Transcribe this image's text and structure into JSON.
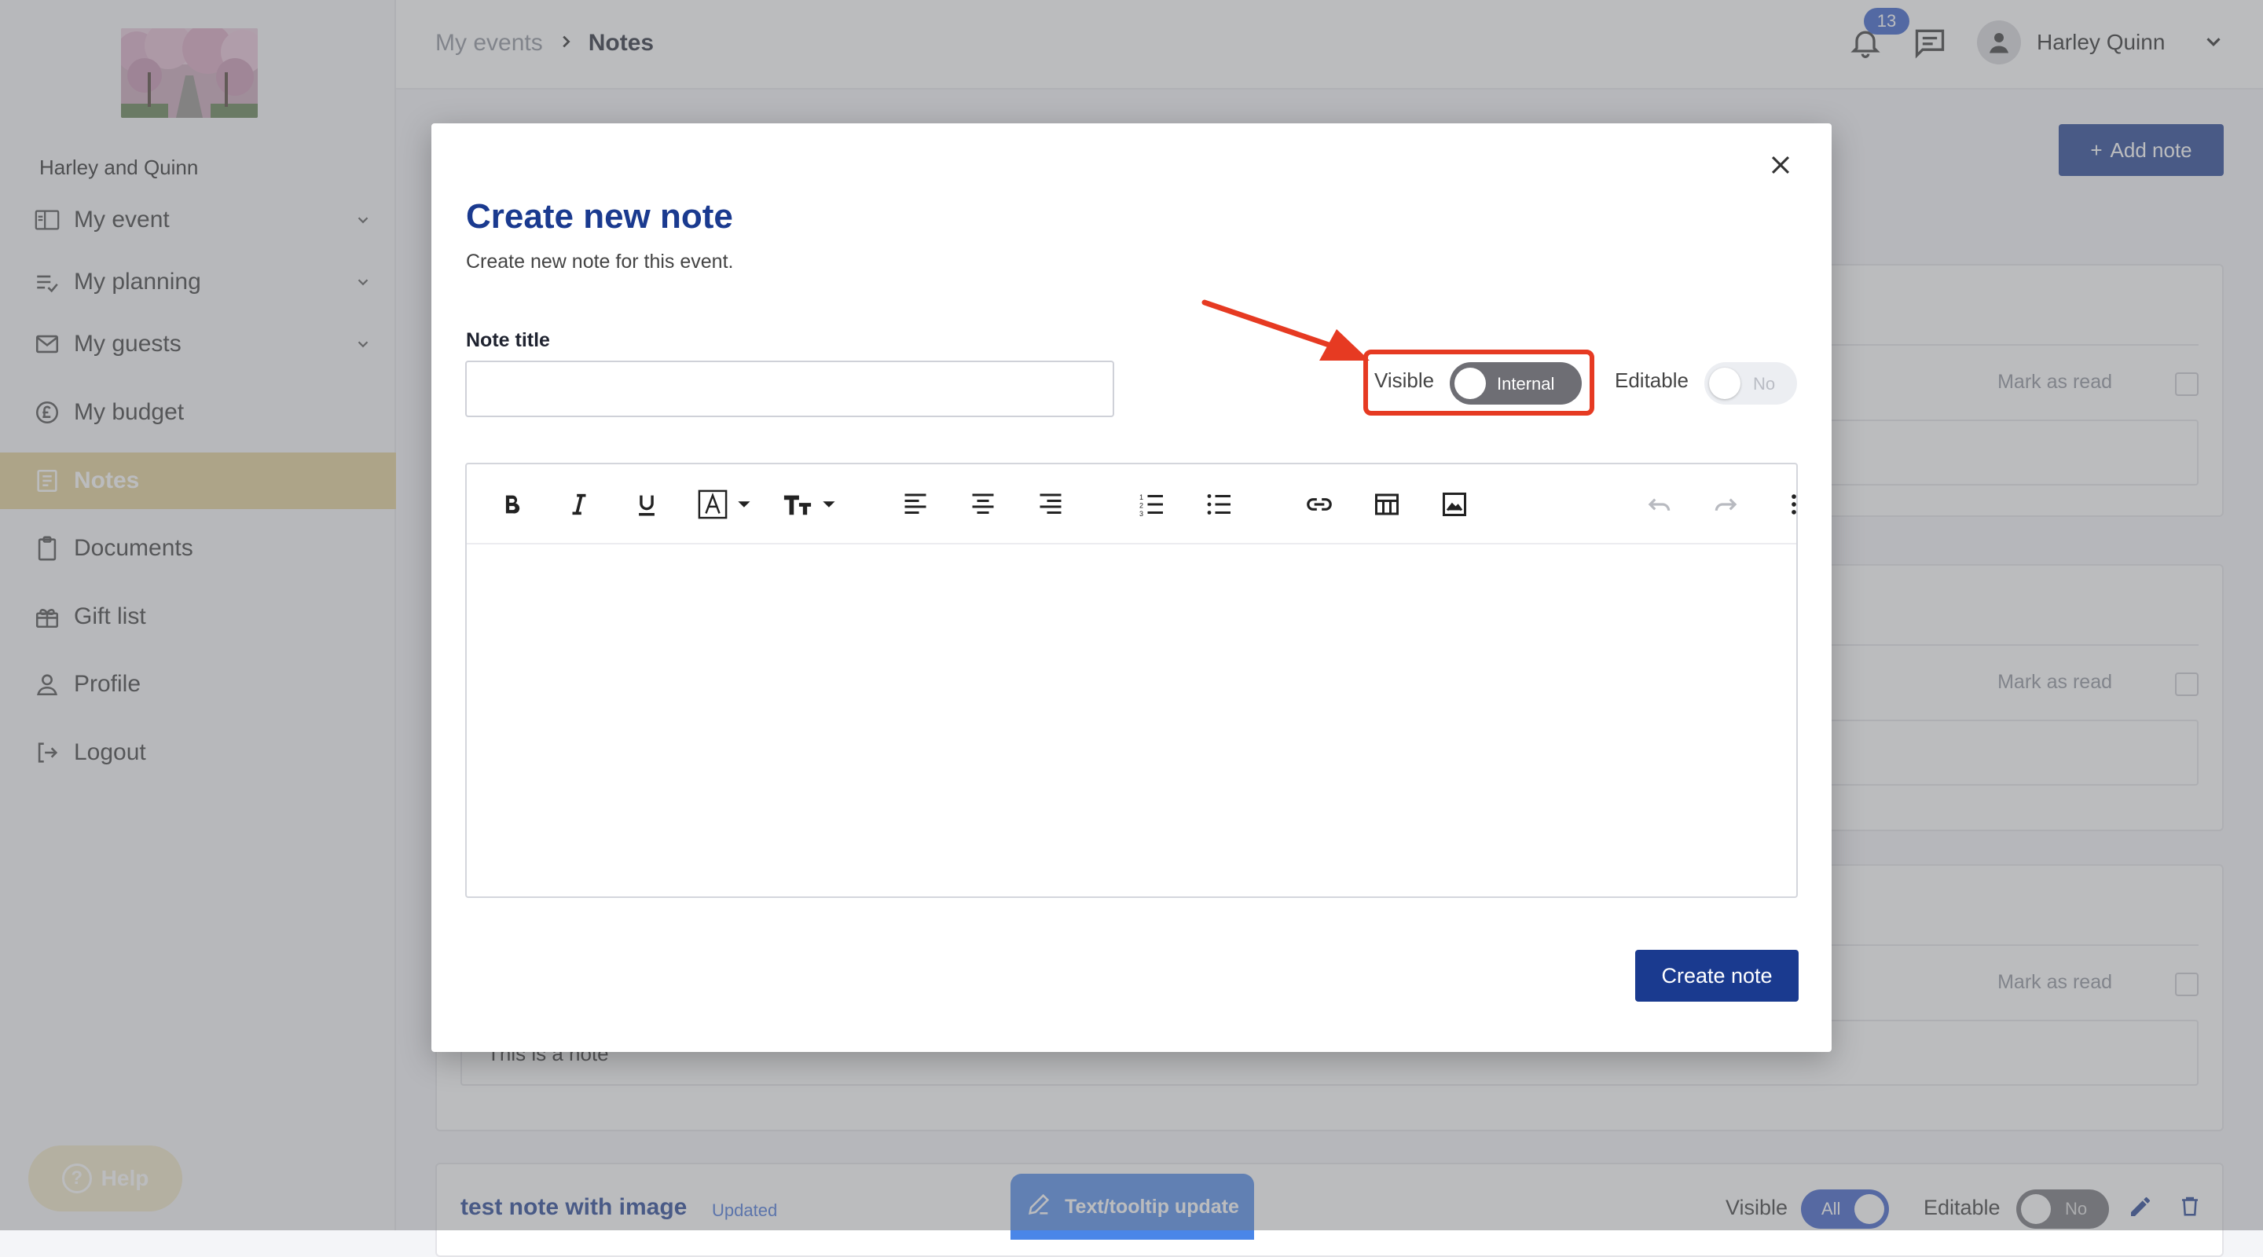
{
  "sidebar": {
    "event_name": "Harley and Quinn",
    "items": [
      {
        "label": "My event",
        "icon": "event-card-icon",
        "has_chevron": true
      },
      {
        "label": "My planning",
        "icon": "planning-list-icon",
        "has_chevron": true
      },
      {
        "label": "My guests",
        "icon": "mail-icon",
        "has_chevron": true
      },
      {
        "label": "My budget",
        "icon": "pound-coin-icon",
        "has_chevron": false
      },
      {
        "label": "Notes",
        "icon": "notes-icon",
        "has_chevron": false,
        "active": true
      },
      {
        "label": "Documents",
        "icon": "clipboard-icon",
        "has_chevron": false
      },
      {
        "label": "Gift list",
        "icon": "gift-icon",
        "has_chevron": false
      },
      {
        "label": "Profile",
        "icon": "person-icon",
        "has_chevron": false
      },
      {
        "label": "Logout",
        "icon": "logout-icon",
        "has_chevron": false
      }
    ],
    "help_label": "Help"
  },
  "header": {
    "breadcrumb": {
      "parent": "My events",
      "current": "Notes"
    },
    "notification_count": "13",
    "user_name": "Harley Quinn"
  },
  "page": {
    "add_note_label": "Add note",
    "mark_as_read": "Mark as read",
    "visible_partial_text": "This is a note",
    "bottom_card": {
      "title": "test note with image",
      "status": "Updated",
      "visible_label": "Visible",
      "visible_value": "All",
      "editable_label": "Editable",
      "editable_value": "No"
    },
    "tooltip_update_label": "Text/tooltip update"
  },
  "modal": {
    "title": "Create new note",
    "subtitle": "Create new note for this event.",
    "note_title_label": "Note title",
    "note_title_value": "",
    "visible_label": "Visible",
    "visible_toggle_value": "Internal",
    "editable_label": "Editable",
    "editable_toggle_value": "No",
    "create_button_label": "Create note"
  },
  "colors": {
    "primary": "#1a3a8f",
    "sidebar_active": "#e3cf93",
    "highlight": "#e63a22",
    "badge": "#2e59c9"
  }
}
